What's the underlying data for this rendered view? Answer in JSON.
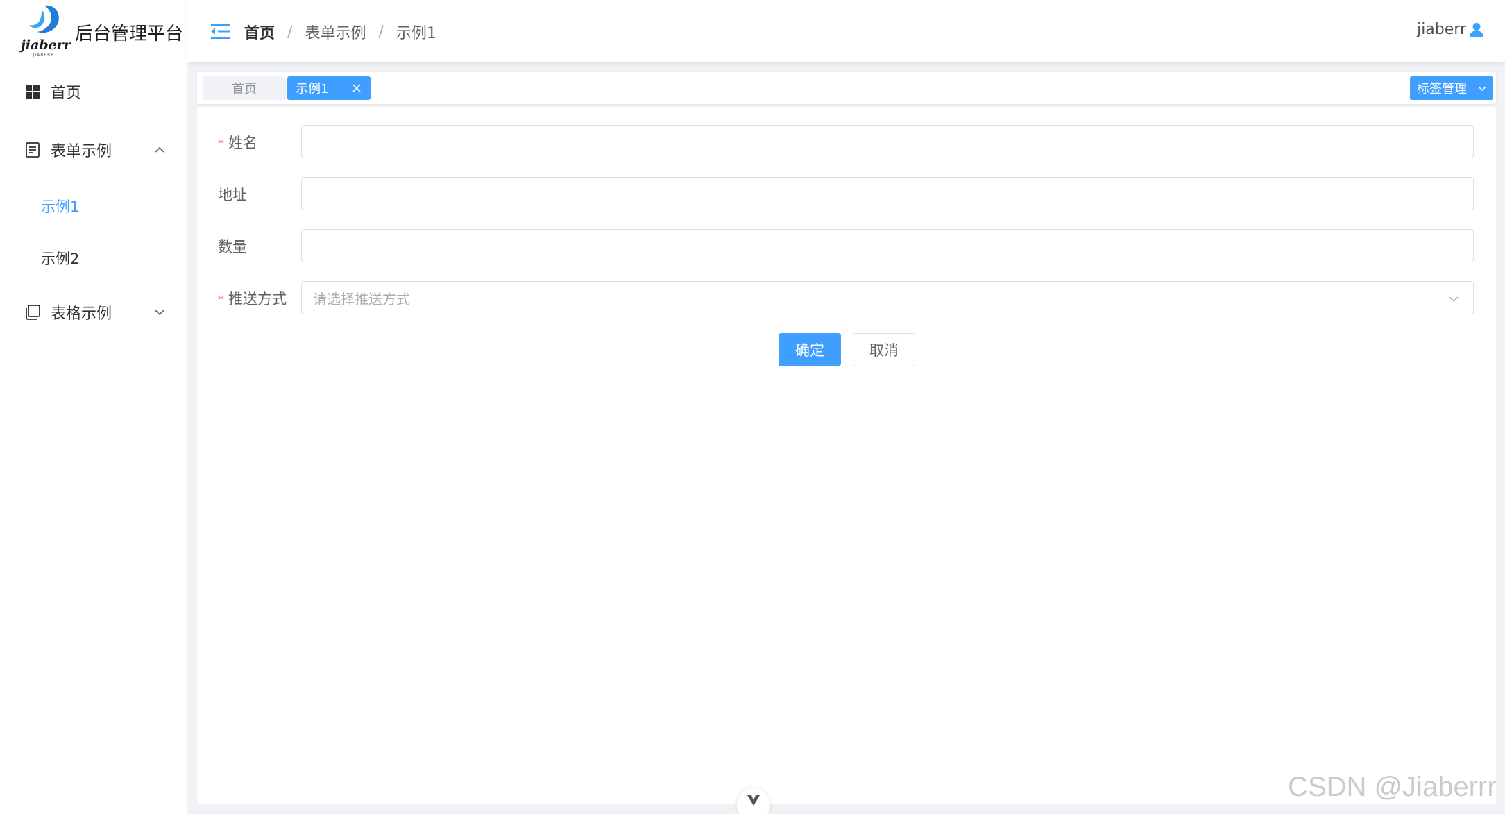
{
  "app": {
    "logo_text": "jiaberr",
    "logo_sub": "JIABERR",
    "title": "后台管理平台"
  },
  "sidebar": {
    "items": [
      {
        "label": "首页",
        "icon": "grid-icon"
      },
      {
        "label": "表单示例",
        "icon": "document-icon",
        "expanded": true,
        "children": [
          {
            "label": "示例1",
            "active": true
          },
          {
            "label": "示例2",
            "active": false
          }
        ]
      },
      {
        "label": "表格示例",
        "icon": "copy-icon",
        "expanded": false
      }
    ]
  },
  "header": {
    "breadcrumb": [
      "首页",
      "表单示例",
      "示例1"
    ],
    "breadcrumb_sep": "/",
    "username": "jiaberr"
  },
  "tags": {
    "items": [
      {
        "label": "首页",
        "active": false
      },
      {
        "label": "示例1",
        "active": true
      }
    ],
    "manage_label": "标签管理"
  },
  "form": {
    "fields": [
      {
        "label": "姓名",
        "required": true,
        "value": "",
        "placeholder": ""
      },
      {
        "label": "地址",
        "required": false,
        "value": "",
        "placeholder": ""
      },
      {
        "label": "数量",
        "required": false,
        "value": "",
        "placeholder": ""
      },
      {
        "label": "推送方式",
        "required": true,
        "type": "select",
        "placeholder": "请选择推送方式"
      }
    ],
    "required_mark": "*",
    "submit_label": "确定",
    "cancel_label": "取消"
  },
  "watermark": "CSDN @Jiaberrr",
  "colors": {
    "primary": "#409eff",
    "required": "#f56c6c",
    "page_bg": "#f0f2f5"
  }
}
